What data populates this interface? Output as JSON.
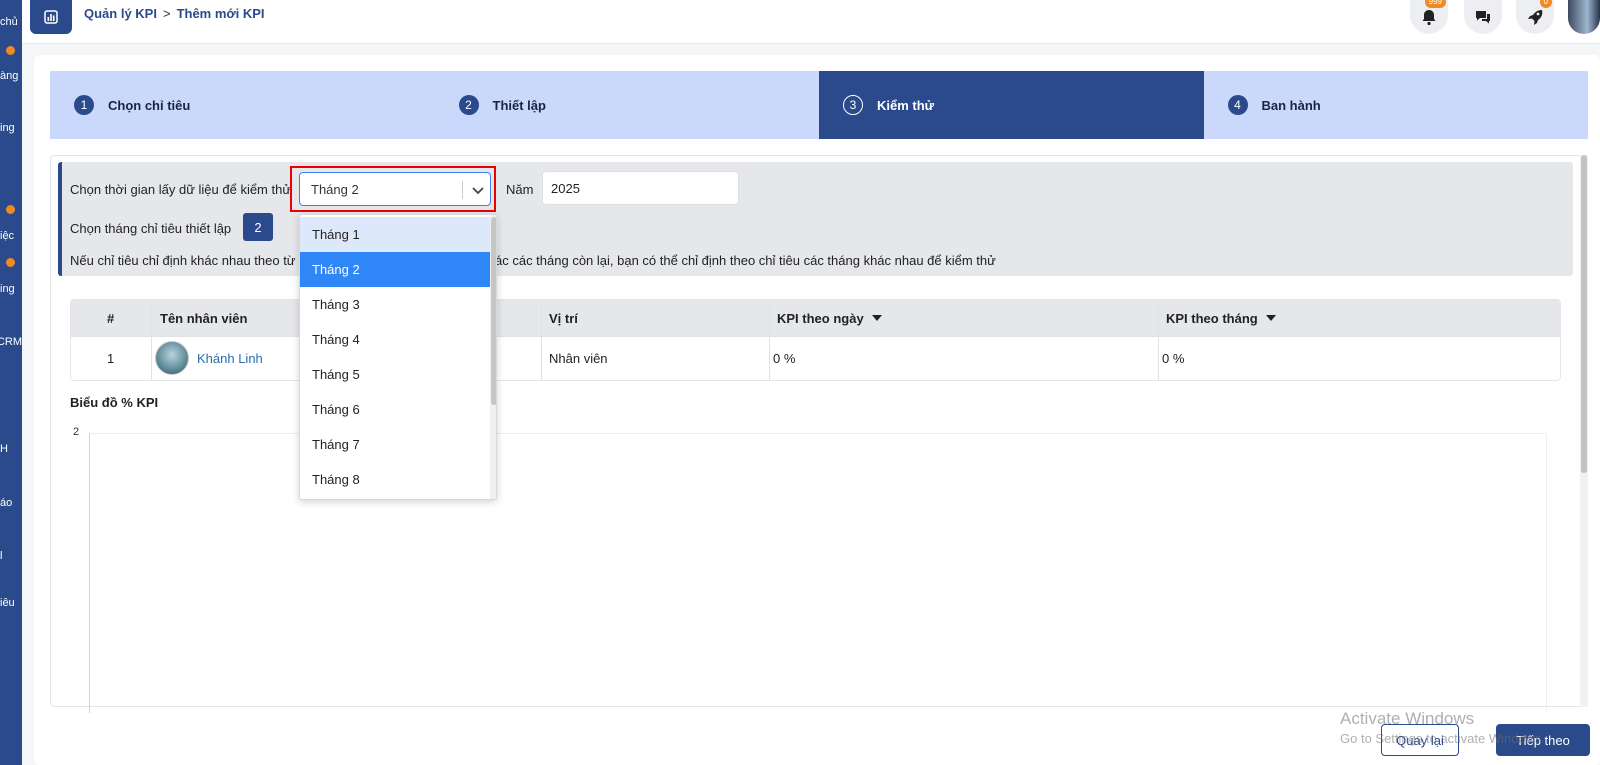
{
  "sidebar": {
    "items": [
      "chủ",
      "àng",
      "ing",
      "iệc",
      "ing",
      "CRM",
      "H",
      "áo",
      "l",
      "iêu"
    ]
  },
  "header": {
    "breadcrumb": [
      "Quản lý KPI",
      "Thêm mới KPI"
    ],
    "breadcrumb_separator": ">",
    "notification_badge": "999",
    "rocket_badge": "0",
    "icons": [
      "chart-icon",
      "bell-icon",
      "chat-icon",
      "rocket-icon"
    ]
  },
  "steps": [
    {
      "num": "1",
      "label": "Chọn chỉ tiêu",
      "active": false
    },
    {
      "num": "2",
      "label": "Thiết lập",
      "active": false
    },
    {
      "num": "3",
      "label": "Kiểm thử",
      "active": true
    },
    {
      "num": "4",
      "label": "Ban hành",
      "active": false
    }
  ],
  "filter": {
    "time_label": "Chọn thời gian lấy dữ liệu để kiểm thử",
    "month_value": "Tháng 2",
    "year_label": "Năm",
    "year_value": "2025",
    "setup_month_label": "Chọn tháng chỉ tiêu thiết lập",
    "setup_month_value": "2",
    "note_start": "Nếu chỉ tiêu chỉ định khác nhau theo từ",
    "note_end": "ác các tháng còn lại, bạn có thể chỉ định theo chỉ tiêu các tháng khác nhau để kiểm thử"
  },
  "dropdown": {
    "options": [
      "Tháng 1",
      "Tháng 2",
      "Tháng 3",
      "Tháng 4",
      "Tháng 5",
      "Tháng 6",
      "Tháng 7",
      "Tháng 8"
    ],
    "selected": "Tháng 2",
    "hovered": "Tháng 1"
  },
  "table": {
    "headers": {
      "index": "#",
      "name": "Tên nhân viên",
      "position": "Vị trí",
      "kpi_day": "KPI theo ngày",
      "kpi_month": "KPI theo tháng"
    },
    "rows": [
      {
        "index": "1",
        "name": "Khánh Linh",
        "position": "Nhân viên",
        "kpi_day": "0 %",
        "kpi_month": "0 %"
      }
    ]
  },
  "chart": {
    "title": "Biểu đồ % KPI",
    "y_tick_top": "2"
  },
  "footer": {
    "back_label": "Quay lại",
    "next_label": "Tiếp theo"
  },
  "watermark": {
    "line1": "Activate Windows",
    "line2": "Go to Settings to activate Windows."
  }
}
